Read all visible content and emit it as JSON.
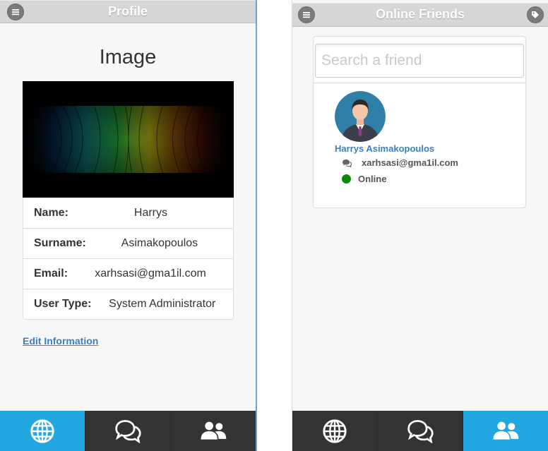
{
  "profile_screen": {
    "header_title": "Profile",
    "menu_icon": "hamburger-menu-icon",
    "heading": "Image",
    "fields": [
      {
        "label": "Name:",
        "value": "Harrys"
      },
      {
        "label": "Surname:",
        "value": "Asimakopoulos"
      },
      {
        "label": "Email:",
        "value": "xarhsasi@gma1il.com"
      },
      {
        "label": "User Type:",
        "value": "System Administrator"
      }
    ],
    "edit_link": "Edit Information",
    "nav": {
      "items": [
        {
          "icon": "globe-icon",
          "active": true
        },
        {
          "icon": "chat-bubbles-icon",
          "active": false
        },
        {
          "icon": "users-icon",
          "active": false
        }
      ]
    }
  },
  "friends_screen": {
    "header_title": "Online Friends",
    "menu_icon": "hamburger-menu-icon",
    "tag_icon": "tag-icon",
    "search": {
      "placeholder": "Search a friend",
      "value": ""
    },
    "friends": [
      {
        "name": "Harrys Asimakopoulos",
        "email": "xarhsasi@gma1il.com",
        "status": "Online",
        "status_color": "#0a8a0a"
      }
    ],
    "nav": {
      "items": [
        {
          "icon": "globe-icon",
          "active": false
        },
        {
          "icon": "chat-bubbles-icon",
          "active": false
        },
        {
          "icon": "users-icon",
          "active": true
        }
      ]
    }
  },
  "colors": {
    "header_bg": "#d6d6d6",
    "nav_bg": "#333333",
    "nav_active": "#22a7e0",
    "link": "#3a7fc0",
    "online": "#0a8a0a"
  }
}
